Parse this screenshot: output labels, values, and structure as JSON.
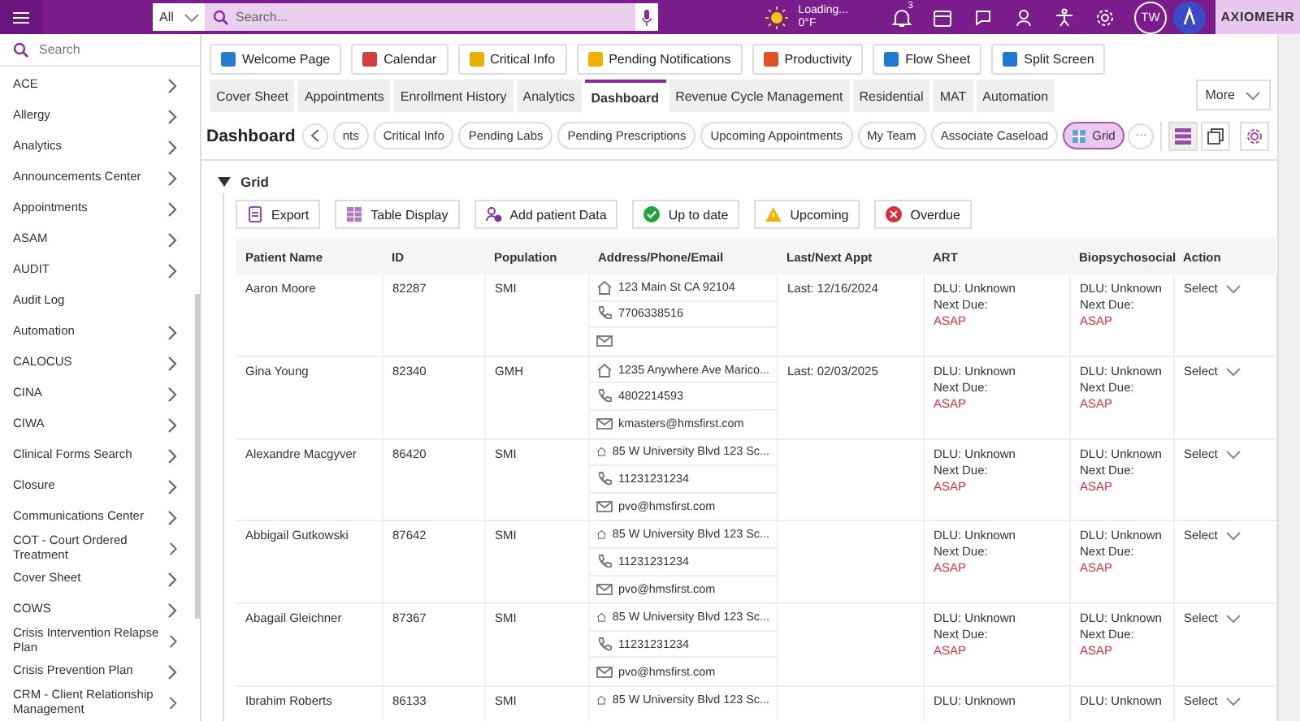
{
  "topbar": {
    "scope": "All",
    "search_placeholder": "Search...",
    "weather": {
      "status": "Loading...",
      "temp": "0°F"
    },
    "notifications": "3",
    "avatar": "TW",
    "logo": "AXIOMEHR"
  },
  "sidebar": {
    "search_placeholder": "Search",
    "items": [
      {
        "label": "ACE",
        "chevron": true
      },
      {
        "label": "Allergy",
        "chevron": true
      },
      {
        "label": "Analytics",
        "chevron": true
      },
      {
        "label": "Announcements Center",
        "chevron": true
      },
      {
        "label": "Appointments",
        "chevron": true
      },
      {
        "label": "ASAM",
        "chevron": true
      },
      {
        "label": "AUDIT",
        "chevron": true
      },
      {
        "label": "Audit Log",
        "chevron": false
      },
      {
        "label": "Automation",
        "chevron": true
      },
      {
        "label": "CALOCUS",
        "chevron": true
      },
      {
        "label": "CINA",
        "chevron": true
      },
      {
        "label": "CIWA",
        "chevron": true
      },
      {
        "label": "Clinical Forms Search",
        "chevron": true
      },
      {
        "label": "Closure",
        "chevron": true
      },
      {
        "label": "Communications Center",
        "chevron": true
      },
      {
        "label": "COT - Court Ordered Treatment",
        "chevron": true
      },
      {
        "label": "Cover Sheet",
        "chevron": true
      },
      {
        "label": "COWS",
        "chevron": true
      },
      {
        "label": "Crisis Intervention Relapse Plan",
        "chevron": true
      },
      {
        "label": "Crisis Prevention Plan",
        "chevron": true
      },
      {
        "label": "CRM - Client Relationship Management",
        "chevron": true
      }
    ]
  },
  "quick_links": [
    {
      "label": "Welcome Page",
      "color": "#2a7bd6"
    },
    {
      "label": "Calendar",
      "color": "#d04040"
    },
    {
      "label": "Critical Info",
      "color": "#e8b000"
    },
    {
      "label": "Pending Notifications",
      "color": "#f0b000"
    },
    {
      "label": "Productivity",
      "color": "#e0502a"
    },
    {
      "label": "Flow Sheet",
      "color": "#1f78d1"
    },
    {
      "label": "Split Screen",
      "color": "#1f78d1"
    }
  ],
  "tabs": [
    {
      "label": "Cover Sheet",
      "selected": false
    },
    {
      "label": "Appointments",
      "selected": false
    },
    {
      "label": "Enrollment History",
      "selected": false
    },
    {
      "label": "Analytics",
      "selected": false
    },
    {
      "label": "Dashboard",
      "selected": true
    },
    {
      "label": "Revenue Cycle Management",
      "selected": false
    },
    {
      "label": "Residential",
      "selected": false
    },
    {
      "label": "MAT",
      "selected": false
    },
    {
      "label": "Automation",
      "selected": false
    }
  ],
  "more": "More",
  "dashboard": {
    "title": "Dashboard",
    "pills": [
      {
        "label": "nts",
        "selected": false
      },
      {
        "label": "Critical Info",
        "selected": false
      },
      {
        "label": "Pending Labs",
        "selected": false
      },
      {
        "label": "Pending Prescriptions",
        "selected": false
      },
      {
        "label": "Upcoming Appointments",
        "selected": false
      },
      {
        "label": "My Team",
        "selected": false
      },
      {
        "label": "Associate Caseload",
        "selected": false
      },
      {
        "label": "Grid",
        "selected": true
      }
    ],
    "more_pills": "···"
  },
  "grid": {
    "title": "Grid",
    "expanded": true,
    "actions": [
      {
        "label": "Export",
        "kind": "export"
      },
      {
        "label": "Table Display",
        "kind": "table"
      },
      {
        "label": "Add patient Data",
        "kind": "add"
      },
      {
        "label": "Up to date",
        "kind": "ok"
      },
      {
        "label": "Upcoming",
        "kind": "warn"
      },
      {
        "label": "Overdue",
        "kind": "error"
      }
    ],
    "table": {
      "columns": [
        "Patient Name",
        "ID",
        "Population",
        "Address/Phone/Email",
        "Last/Next Appt",
        "ART",
        "Biopsychosocial",
        "Action"
      ],
      "rows": [
        {
          "name": "Aaron Moore",
          "id": "82287",
          "population": "SMI",
          "address": "123 Main St CA 92104",
          "phone": "7706338516",
          "email": "",
          "appt": "Last: 12/16/2024",
          "art": {
            "dlu": "DLU: Unknown",
            "next": "Next Due:",
            "due": "ASAP"
          },
          "bio": {
            "dlu": "DLU: Unknown",
            "next": "Next Due:",
            "due": "ASAP"
          },
          "action": "Select"
        },
        {
          "name": "Gina Young",
          "id": "82340",
          "population": "GMH",
          "address": "1235 Anywhere Ave Marico...",
          "phone": "4802214593",
          "email": "kmasters@hmsfirst.com",
          "appt": "Last: 02/03/2025",
          "art": {
            "dlu": "DLU: Unknown",
            "next": "Next Due:",
            "due": "ASAP"
          },
          "bio": {
            "dlu": "DLU: Unknown",
            "next": "Next Due:",
            "due": "ASAP"
          },
          "action": "Select"
        },
        {
          "name": "Alexandre Macgyver",
          "id": "86420",
          "population": "SMI",
          "address": "85 W University Blvd 123 Sc...",
          "phone": "11231231234",
          "email": "pvo@hmsfirst.com",
          "appt": "",
          "art": {
            "dlu": "DLU: Unknown",
            "next": "Next Due:",
            "due": "ASAP"
          },
          "bio": {
            "dlu": "DLU: Unknown",
            "next": "Next Due:",
            "due": "ASAP"
          },
          "action": "Select"
        },
        {
          "name": "Abbigail Gutkowski",
          "id": "87642",
          "population": "SMI",
          "address": "85 W University Blvd 123 Sc...",
          "phone": "11231231234",
          "email": "pvo@hmsfirst.com",
          "appt": "",
          "art": {
            "dlu": "DLU: Unknown",
            "next": "Next Due:",
            "due": "ASAP"
          },
          "bio": {
            "dlu": "DLU: Unknown",
            "next": "Next Due:",
            "due": "ASAP"
          },
          "action": "Select"
        },
        {
          "name": "Abagail Gleichner",
          "id": "87367",
          "population": "SMI",
          "address": "85 W University Blvd 123 Sc...",
          "phone": "11231231234",
          "email": "pvo@hmsfirst.com",
          "appt": "",
          "art": {
            "dlu": "DLU: Unknown",
            "next": "Next Due:",
            "due": "ASAP"
          },
          "bio": {
            "dlu": "DLU: Unknown",
            "next": "Next Due:",
            "due": "ASAP"
          },
          "action": "Select"
        },
        {
          "name": "Ibrahim Roberts",
          "id": "86133",
          "population": "SMI",
          "address": "85 W University Blvd 123 Sc...",
          "appt": "",
          "art": {
            "dlu": "DLU: Unknown"
          },
          "bio": {
            "dlu": "DLU: Unknown"
          },
          "action": "Select"
        }
      ]
    }
  }
}
